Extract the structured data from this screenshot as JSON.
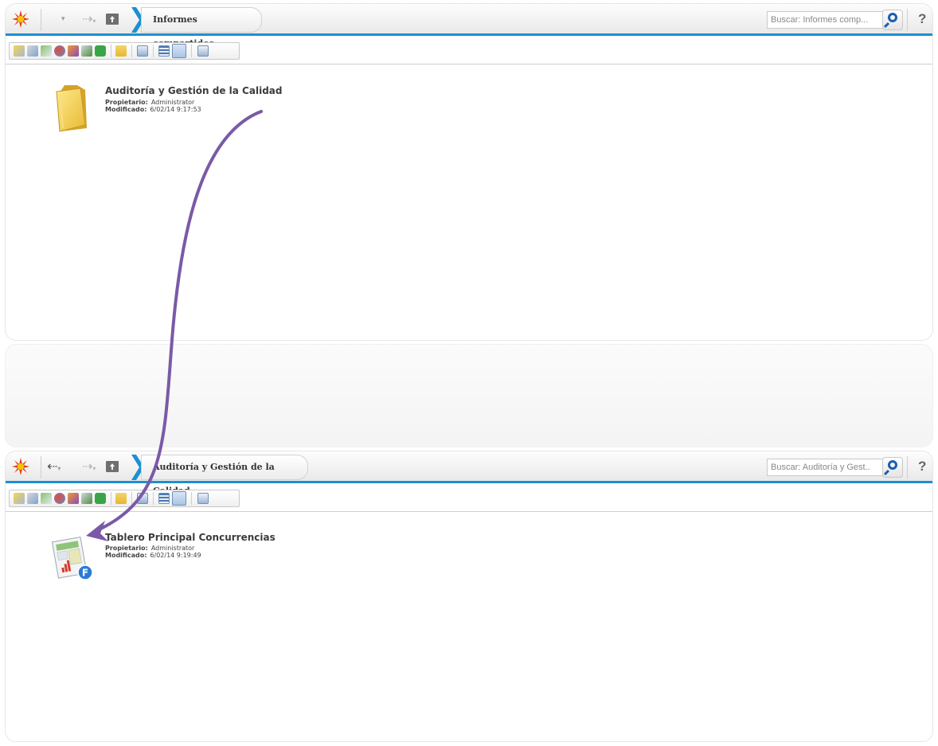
{
  "colors": {
    "accent": "#1d8fd1",
    "arrow": "#7a5aa6",
    "logo": "#e0401c"
  },
  "top": {
    "breadcrumb": "Informes compartidos",
    "search_placeholder": "Buscar: Informes comp...",
    "help": "?",
    "item": {
      "title": "Auditoría y Gestión de la Calidad",
      "owner_label": "Propietario:",
      "owner": "Administrator",
      "modified_label": "Modificado:",
      "modified": "6/02/14 9:17:53",
      "icon": "folder-icon"
    }
  },
  "bottom": {
    "breadcrumb": "Auditoría y Gestión de la Calidad",
    "search_placeholder": "Buscar: Auditoría y Gest..",
    "help": "?",
    "item": {
      "title": "Tablero Principal Concurrencias",
      "owner_label": "Propietario:",
      "owner": "Administrator",
      "modified_label": "Modificado:",
      "modified": "6/02/14 9:19:49",
      "icon": "dashboard-report-icon",
      "badge": "F"
    }
  }
}
